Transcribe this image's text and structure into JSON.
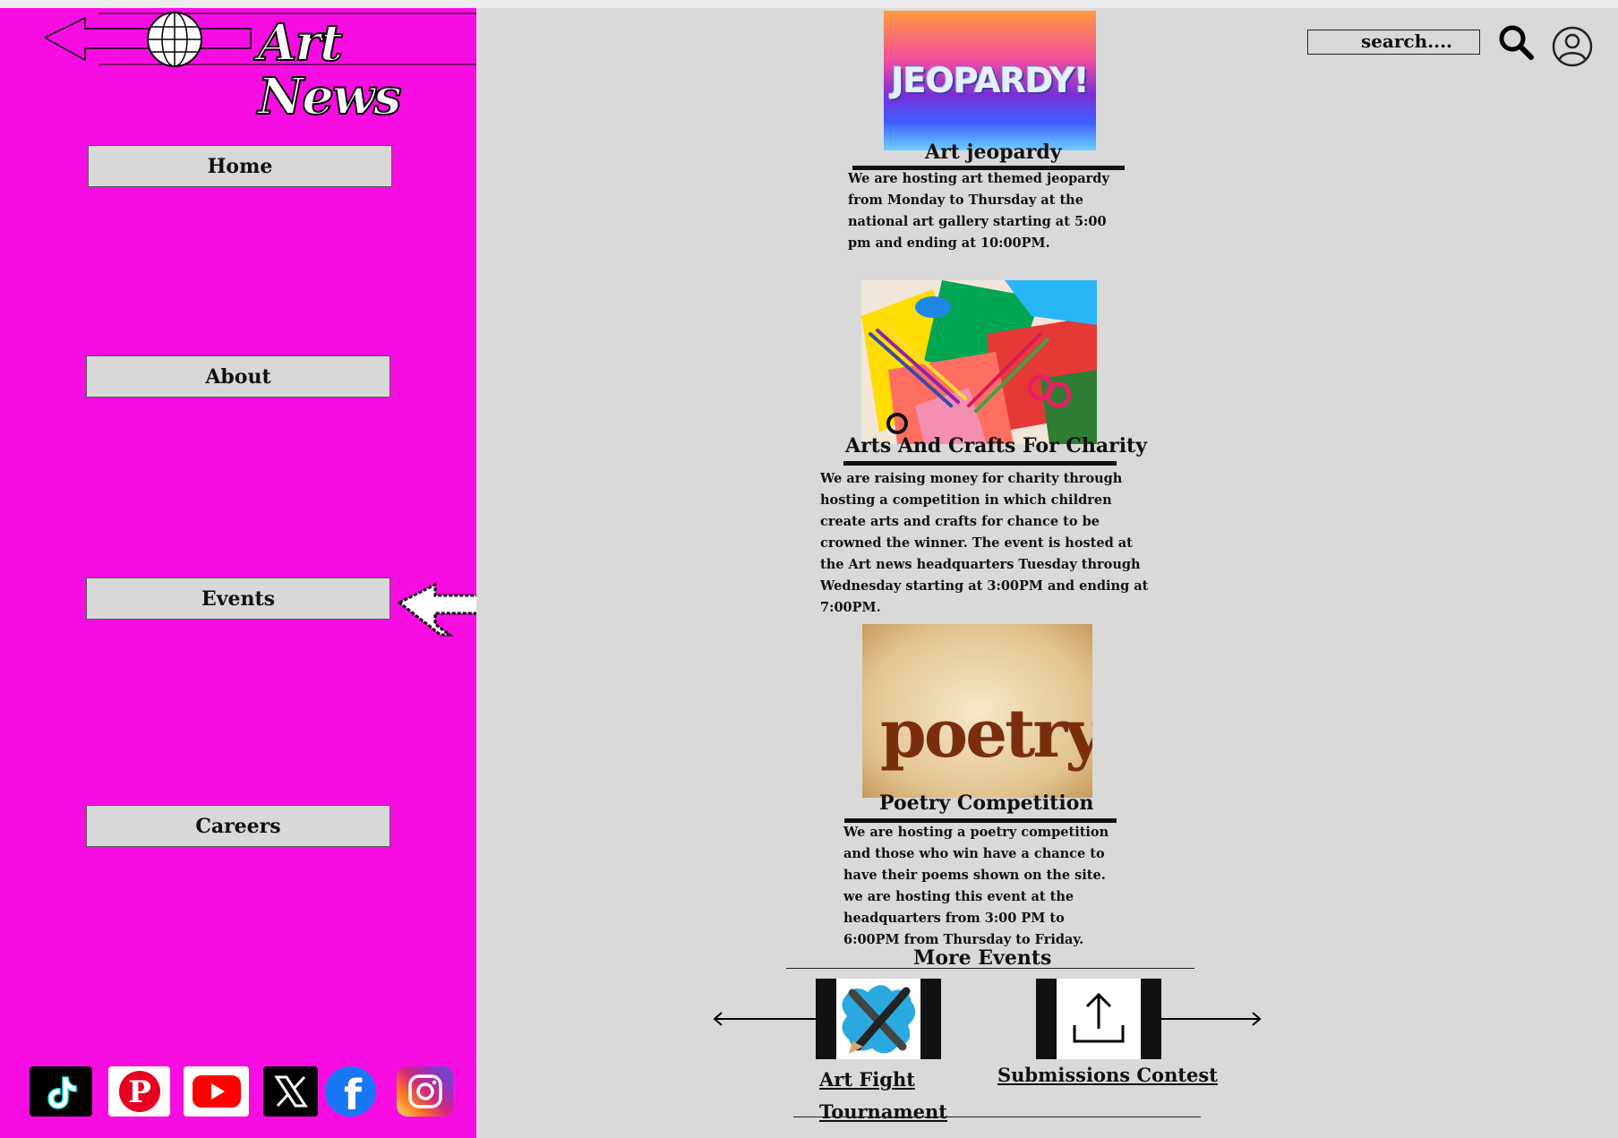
{
  "brand": {
    "logo_text": "Art News"
  },
  "nav": {
    "home": "Home",
    "about": "About",
    "events": "Events",
    "careers": "Careers"
  },
  "header": {
    "search_placeholder": "search...."
  },
  "events": [
    {
      "title": "Art jeopardy",
      "image_text": "JEOPARDY!",
      "description": "We are hosting art themed jeopardy from Monday to Thursday at the national art gallery starting at 5:00 pm and ending at 10:00PM."
    },
    {
      "title": "Arts And Crafts For Charity",
      "description": "We are raising money for charity through hosting a competition in which children create arts and crafts for chance to be crowned the winner. The event is hosted at the Art news headquarters Tuesday through Wednesday starting at 3:00PM and ending at 7:00PM."
    },
    {
      "title": "Poetry Competition",
      "image_text": "poetry",
      "description": "We are hosting a poetry competition and those who win have a chance to have their poems shown on the site. we are hosting this event at the headquarters from 3:00 PM to 6:00PM from Thursday to Friday."
    }
  ],
  "more_events": {
    "title": "More Events",
    "items": [
      {
        "label": "Art Fight Tournament",
        "icon": "brush-pencil-icon"
      },
      {
        "label": "Submissions Contest",
        "icon": "upload-icon"
      }
    ]
  },
  "social": [
    {
      "name": "tiktok",
      "color": "#000000"
    },
    {
      "name": "pinterest",
      "color": "#e60023"
    },
    {
      "name": "youtube",
      "color": "#ff0000"
    },
    {
      "name": "x",
      "color": "#000000"
    },
    {
      "name": "facebook",
      "color": "#1877f2"
    },
    {
      "name": "instagram",
      "color": "#dd2a7b"
    }
  ],
  "colors": {
    "sidebar": "#f70de2",
    "main_bg": "#d9d9d9",
    "button_bg": "#d8d8d8"
  }
}
